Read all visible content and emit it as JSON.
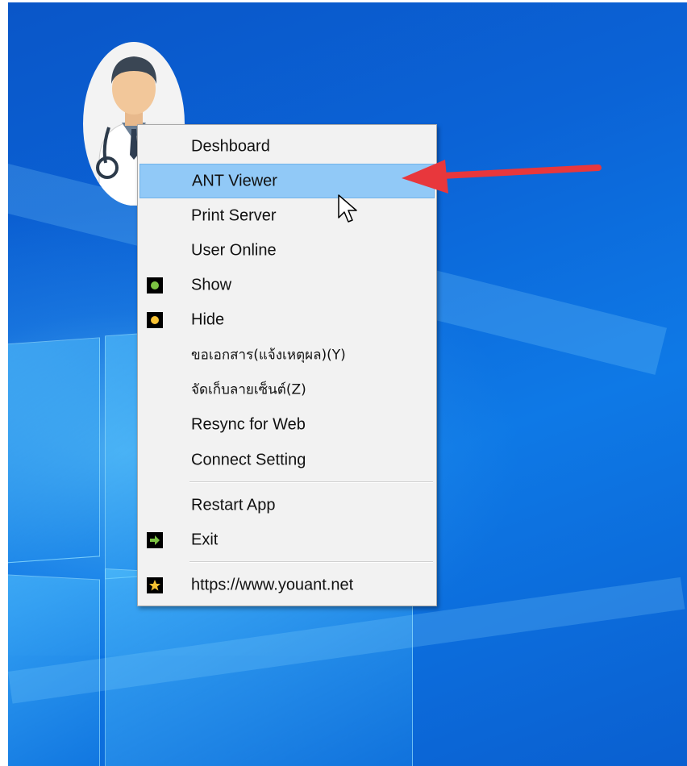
{
  "desktop": {
    "background_color": "#0b63d6",
    "accent_glow_color": "#6fd0ff"
  },
  "tray_app": {
    "icon": "doctor-avatar-icon"
  },
  "context_menu": {
    "highlight_color": "#91c9f7",
    "items": [
      {
        "label": "Deshboard",
        "icon": null
      },
      {
        "label": "ANT Viewer",
        "icon": null,
        "highlighted": true
      },
      {
        "label": "Print Server",
        "icon": null
      },
      {
        "label": "User Online",
        "icon": null
      },
      {
        "label": "Show",
        "icon": "green-dot-icon"
      },
      {
        "label": "Hide",
        "icon": "yellow-dot-icon"
      },
      {
        "label": "ขอเอกสาร(แจ้งเหตุผล)(Y)",
        "icon": null
      },
      {
        "label": "จัดเก็บลายเซ็นต์(Z)",
        "icon": null
      },
      {
        "label": "Resync for Web",
        "icon": null
      },
      {
        "label": "Connect Setting",
        "icon": null
      },
      {
        "label": "Restart App",
        "icon": null
      },
      {
        "label": "Exit",
        "icon": "green-arrow-right-icon"
      },
      {
        "label": "https://www.youant.net",
        "icon": "star-icon"
      }
    ]
  },
  "annotation": {
    "arrow_color": "#e8373c",
    "points_to": "ANT Viewer"
  }
}
